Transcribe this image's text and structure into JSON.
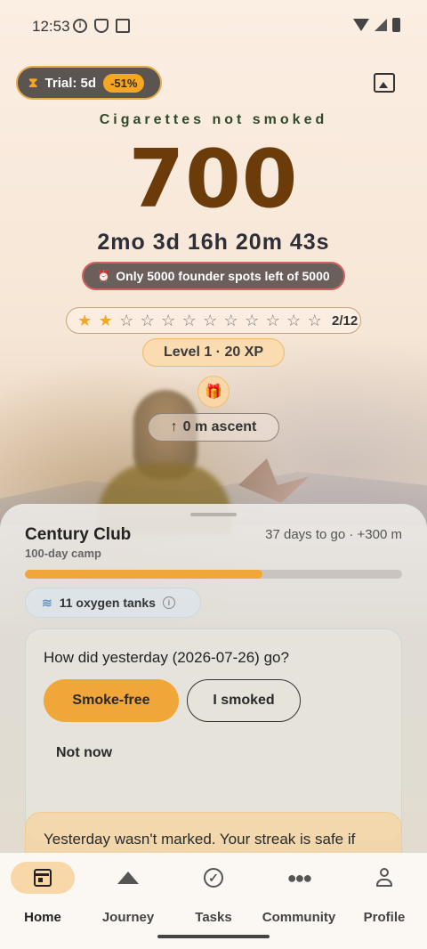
{
  "status_bar": {
    "time": "12:53"
  },
  "trial": {
    "label": "Trial: 5d",
    "discount": "-51%"
  },
  "counter": {
    "label": "Cigarettes not smoked",
    "value": "700",
    "elapsed": "2mo 3d 16h 20m 43s",
    "founder_text": "Only 5000 founder spots left of 5000"
  },
  "stars": {
    "filled": 2,
    "total": 12,
    "count_text": "2/12"
  },
  "level": {
    "text": "Level 1 · 20 XP"
  },
  "ascent": {
    "text": "0 m ascent"
  },
  "goal": {
    "title": "Century Club",
    "subtitle": "100-day camp",
    "meta": "37 days to go · +300 m",
    "progress_fraction": 0.63
  },
  "oxygen": {
    "text": "11 oxygen tanks"
  },
  "checkin": {
    "question": "How did yesterday (2026-07-26) go?",
    "smoke_free": "Smoke-free",
    "smoked": "I smoked",
    "not_now": "Not now"
  },
  "notice": {
    "text": "Yesterday wasn't marked. Your streak is safe if"
  },
  "nav": {
    "items": [
      {
        "label": "Home",
        "icon": "calendar-icon"
      },
      {
        "label": "Journey",
        "icon": "mountain-icon"
      },
      {
        "label": "Tasks",
        "icon": "check-circle-icon"
      },
      {
        "label": "Community",
        "icon": "people-icon"
      },
      {
        "label": "Profile",
        "icon": "person-icon"
      }
    ],
    "active": "Home"
  },
  "colors": {
    "accent": "#f0a638",
    "counter": "#6b3b0a",
    "title_green": "#2f4a2a"
  }
}
